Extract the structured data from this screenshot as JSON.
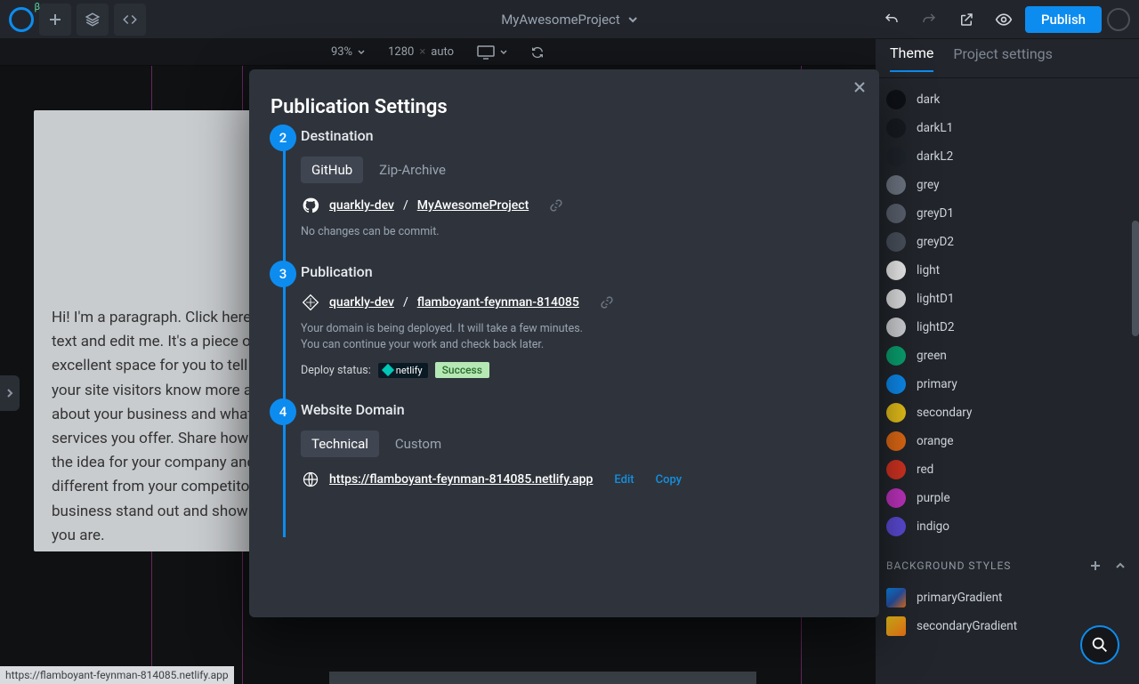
{
  "topbar": {
    "project_name": "MyAwesomeProject",
    "publish_label": "Publish"
  },
  "ctrlbar": {
    "zoom": "93%",
    "width": "1280",
    "times": "×",
    "height": "auto"
  },
  "canvas": {
    "paragraph": "Hi! I'm a paragraph. Click here to add your own text and edit me. It's a piece of cake. I'm an excellent space for you to tell a story and let your site visitors know more about you. Talk about your business and what products and services you offer. Share how you came up with the idea for your company and what makes you different from your competitors. Make your business stand out and show your visitors who you are."
  },
  "sidebar": {
    "tabs": {
      "theme": "Theme",
      "project": "Project settings"
    },
    "colors": [
      {
        "name": "dark",
        "hex": "#0e1116"
      },
      {
        "name": "darkL1",
        "hex": "#171b21"
      },
      {
        "name": "darkL2",
        "hex": "#1f242b"
      },
      {
        "name": "grey",
        "hex": "#6f7784"
      },
      {
        "name": "greyD1",
        "hex": "#5c6370"
      },
      {
        "name": "greyD2",
        "hex": "#4a525e"
      },
      {
        "name": "light",
        "hex": "#f1f1f1"
      },
      {
        "name": "lightD1",
        "hex": "#e2e3e5"
      },
      {
        "name": "lightD2",
        "hex": "#d2d4d7"
      },
      {
        "name": "green",
        "hex": "#0aa371"
      },
      {
        "name": "primary",
        "hex": "#0d8cf0"
      },
      {
        "name": "secondary",
        "hex": "#e8c21a"
      },
      {
        "name": "orange",
        "hex": "#e26a14"
      },
      {
        "name": "red",
        "hex": "#d43322"
      },
      {
        "name": "purple",
        "hex": "#c033c0"
      },
      {
        "name": "indigo",
        "hex": "#5c4bd8"
      }
    ],
    "bg_section": "BACKGROUND STYLES",
    "gradients": [
      {
        "name": "primaryGradient",
        "css": "linear-gradient(135deg,#0d8cf0,#2753a9,#e26a14)"
      },
      {
        "name": "secondaryGradient",
        "css": "linear-gradient(135deg,#e8c21a,#e26a14)"
      }
    ]
  },
  "modal": {
    "title": "Publication Settings",
    "steps": {
      "destination": {
        "num": "2",
        "title": "Destination",
        "tabs": {
          "github": "GitHub",
          "zip": "Zip-Archive"
        },
        "owner": "quarkly-dev",
        "repo": "MyAwesomeProject",
        "note": "No changes can be commit."
      },
      "publication": {
        "num": "3",
        "title": "Publication",
        "owner": "quarkly-dev",
        "site": "flamboyant-feynman-814085",
        "note": "Your domain is being deployed. It will take a few minutes. You can continue your work and check back later.",
        "deploy_label": "Deploy status:",
        "netlify": "netlify",
        "status": "Success"
      },
      "domain": {
        "num": "4",
        "title": "Website Domain",
        "tabs": {
          "technical": "Technical",
          "custom": "Custom"
        },
        "url": "https://flamboyant-feynman-814085.netlify.app",
        "edit": "Edit",
        "copy": "Copy"
      }
    }
  },
  "statusbar": "https://flamboyant-feynman-814085.netlify.app"
}
